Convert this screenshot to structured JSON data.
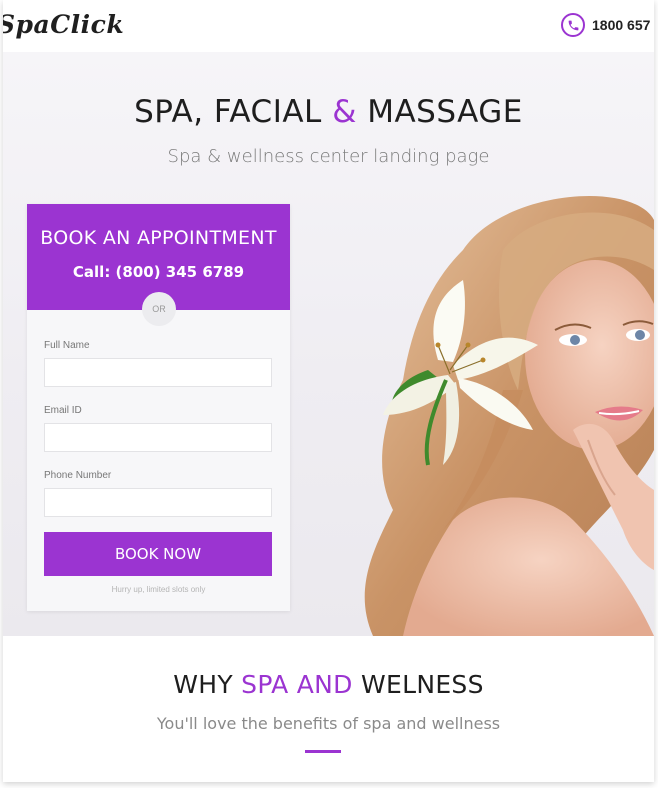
{
  "header": {
    "logo_text": "SpaClick",
    "phone_icon": "phone-icon",
    "phone_number": "1800 657"
  },
  "hero": {
    "title_part1": "SPA, FACIAL ",
    "title_amp": "&",
    "title_part2": " MASSAGE",
    "subtitle": "Spa & wellness center landing page",
    "image": "woman-with-lily-flower-portrait"
  },
  "booking": {
    "title": "BOOK AN APPOINTMENT",
    "call": "Call: (800) 345 6789",
    "or": "OR",
    "fields": [
      {
        "label": "Full Name",
        "value": "",
        "placeholder": ""
      },
      {
        "label": "Email ID",
        "value": "",
        "placeholder": ""
      },
      {
        "label": "Phone Number",
        "value": "",
        "placeholder": ""
      }
    ],
    "button": "BOOK NOW",
    "note": "Hurry up, limited slots only"
  },
  "why": {
    "title_part1": "WHY ",
    "title_accent": "SPA AND",
    "title_part2": " WELNESS",
    "subtitle": "You'll love the benefits of spa and wellness"
  },
  "colors": {
    "accent": "#9b34d1",
    "text_dark": "#1e1e1e",
    "text_muted": "#7a7a7a"
  }
}
